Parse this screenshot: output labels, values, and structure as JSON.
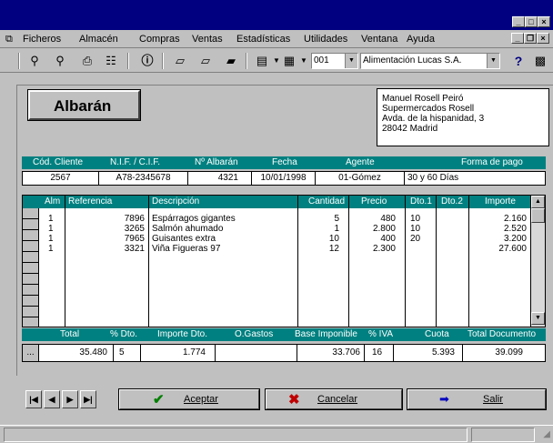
{
  "menu": {
    "items": [
      "Ficheros",
      "Almacén",
      "Compras",
      "Ventas",
      "Estadísticas",
      "Utilidades",
      "Ventana",
      "Ayuda"
    ]
  },
  "toolbar": {
    "combo_value": "001",
    "company": "Alimentación Lucas S.A.",
    "help_glyph": "?"
  },
  "form": {
    "title": "Albarán",
    "address": [
      "Manuel Rosell Peiró",
      "Supermercados Rosell",
      "Avda. de la hispanidad, 3",
      "28042  Madrid"
    ]
  },
  "header_labels": [
    "Cód. Cliente",
    "N.I.F. / C.I.F.",
    "Nº Albarán",
    "Fecha",
    "Agente",
    "Forma de pago"
  ],
  "header_values": {
    "cliente": "2567",
    "nif": "A78-2345678",
    "albaran": "4321",
    "fecha": "10/01/1998",
    "agente": "01-Gómez",
    "forma_pago": "30 y 60 Días"
  },
  "grid": {
    "columns": [
      "Alm",
      "Referencia",
      "Descripción",
      "Cantidad",
      "Precio",
      "Dto.1",
      "Dto.2",
      "Importe"
    ],
    "rows": [
      {
        "alm": "1",
        "ref": "7896",
        "desc": "Espárragos gigantes",
        "cant": "5",
        "precio": "480",
        "dto1": "10",
        "dto2": "",
        "importe": "2.160"
      },
      {
        "alm": "1",
        "ref": "3265",
        "desc": "Salmón ahumado",
        "cant": "1",
        "precio": "2.800",
        "dto1": "10",
        "dto2": "",
        "importe": "2.520"
      },
      {
        "alm": "1",
        "ref": "7965",
        "desc": "Guisantes extra",
        "cant": "10",
        "precio": "400",
        "dto1": "20",
        "dto2": "",
        "importe": "3.200"
      },
      {
        "alm": "1",
        "ref": "3321",
        "desc": "Viña Figueras 97",
        "cant": "12",
        "precio": "2.300",
        "dto1": "",
        "dto2": "",
        "importe": "27.600"
      }
    ]
  },
  "totals_labels": [
    "Total",
    "% Dto.",
    "Importe Dto.",
    "O.Gastos",
    "Base Imponible",
    "% IVA",
    "Cuota",
    "Total Documento"
  ],
  "totals_values": {
    "ellipsis": "...",
    "total": "35.480",
    "dto": "5",
    "importe_dto": "1.774",
    "gastos": "",
    "base": "33.706",
    "iva": "16",
    "cuota": "5.393",
    "total_doc": "39.099"
  },
  "buttons": {
    "aceptar": "Aceptar",
    "cancelar": "Cancelar",
    "salir": "Salir"
  },
  "colors": {
    "title_bar": "#000080",
    "header_teal": "#008080",
    "accept_check": "#008000",
    "cancel_x": "#c00000",
    "exit_arrow": "#0000c0"
  }
}
